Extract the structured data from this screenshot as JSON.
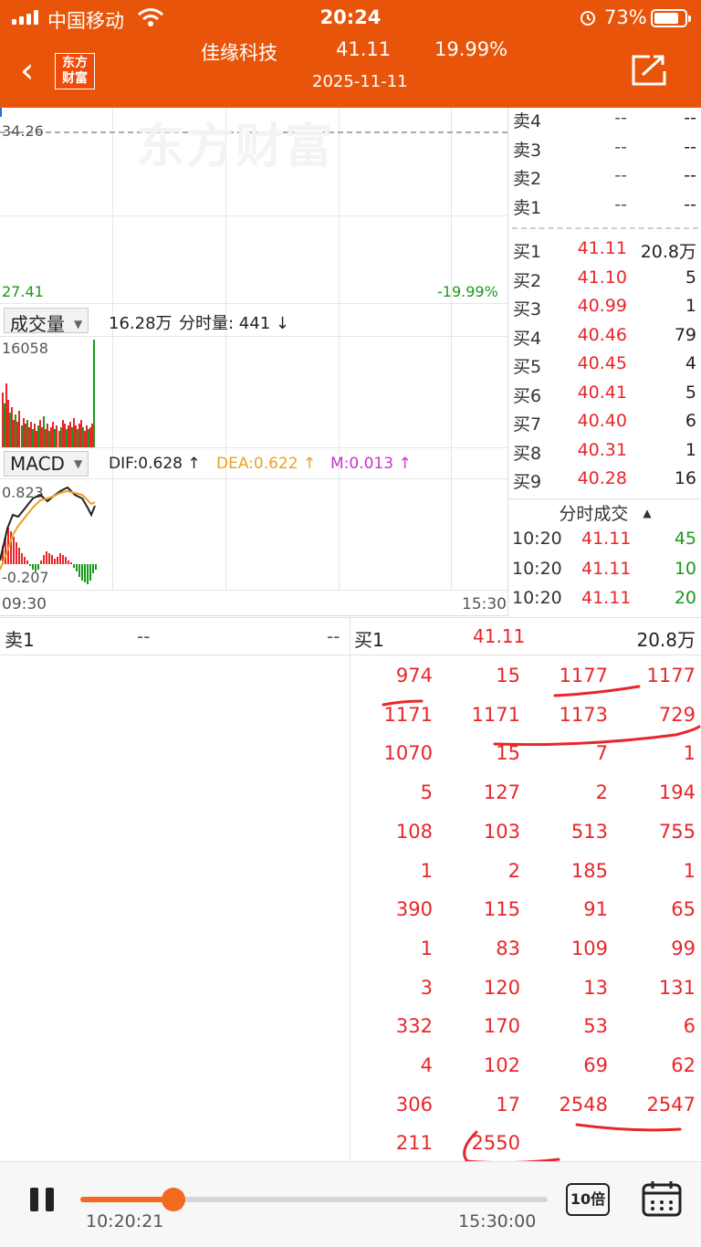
{
  "status_bar": {
    "carrier": "中国移动",
    "time": "20:24",
    "battery_pct": "73%"
  },
  "nav": {
    "back_icon": "chevron-left-icon",
    "logo_text": "东方财富",
    "stock_name": "佳缘科技",
    "price": "41.11",
    "change_pct": "19.99%",
    "date": "2025-11-11",
    "share_icon": "share-icon"
  },
  "chart": {
    "watermark": "东方财富",
    "price_high": "34.26",
    "price_low": "27.41",
    "pct_low": "-19.99%",
    "volume_selector": "成交量",
    "volume_total": "16.28万",
    "tick_volume": "分时量: 441 ↓",
    "volume_max": "16058",
    "macd_selector": "MACD",
    "dif": "DIF:0.628 ↑",
    "dea": "DEA:0.622 ↑",
    "m": "M:0.013 ↑",
    "macd_high": "0.823",
    "macd_low": "-0.207",
    "time_start": "09:30",
    "time_end": "15:30",
    "colors": {
      "up": "#e8262a",
      "down": "#1a9a1a",
      "dif": "#222222",
      "dea": "#f0a020",
      "m": "#cc33cc"
    }
  },
  "order_book": {
    "sell": [
      {
        "label": "卖4",
        "price": "--",
        "vol": "--"
      },
      {
        "label": "卖3",
        "price": "--",
        "vol": "--"
      },
      {
        "label": "卖2",
        "price": "--",
        "vol": "--"
      },
      {
        "label": "卖1",
        "price": "--",
        "vol": "--"
      }
    ],
    "buy": [
      {
        "label": "买1",
        "price": "41.11",
        "vol": "20.8万"
      },
      {
        "label": "买2",
        "price": "41.10",
        "vol": "5"
      },
      {
        "label": "买3",
        "price": "40.99",
        "vol": "1"
      },
      {
        "label": "买4",
        "price": "40.46",
        "vol": "79"
      },
      {
        "label": "买5",
        "price": "40.45",
        "vol": "4"
      },
      {
        "label": "买6",
        "price": "40.41",
        "vol": "5"
      },
      {
        "label": "买7",
        "price": "40.40",
        "vol": "6"
      },
      {
        "label": "买8",
        "price": "40.31",
        "vol": "1"
      },
      {
        "label": "买9",
        "price": "40.28",
        "vol": "16"
      }
    ],
    "trades_title": "分时成交",
    "trades": [
      {
        "time": "10:20",
        "price": "41.11",
        "vol": "45"
      },
      {
        "time": "10:20",
        "price": "41.11",
        "vol": "10"
      },
      {
        "time": "10:20",
        "price": "41.11",
        "vol": "20"
      }
    ]
  },
  "queue": {
    "sell_label": "卖1",
    "sell_price": "--",
    "sell_vol": "--",
    "buy_label": "买1",
    "buy_price": "41.11",
    "buy_vol": "20.8万",
    "buy_orders": [
      "974",
      "15",
      "1177",
      "1177",
      "1171",
      "1171",
      "1173",
      "729",
      "1070",
      "15",
      "7",
      "1",
      "5",
      "127",
      "2",
      "194",
      "108",
      "103",
      "513",
      "755",
      "1",
      "2",
      "185",
      "1",
      "390",
      "115",
      "91",
      "65",
      "1",
      "83",
      "109",
      "99",
      "3",
      "120",
      "13",
      "131",
      "332",
      "170",
      "53",
      "6",
      "4",
      "102",
      "69",
      "62",
      "306",
      "17",
      "2548",
      "2547",
      "211",
      "2550"
    ]
  },
  "playback": {
    "current_time": "10:20:21",
    "end_time": "15:30:00",
    "progress": 0.2,
    "speed": "10倍",
    "pause_icon": "pause-icon",
    "calendar_icon": "calendar-icon"
  }
}
